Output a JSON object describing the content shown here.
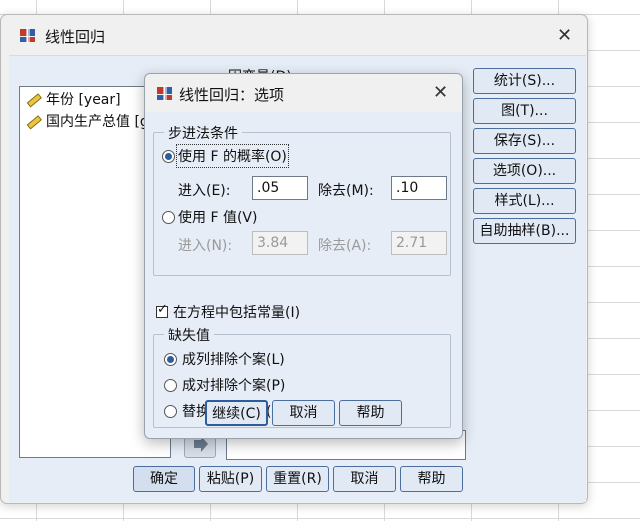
{
  "main_dialog": {
    "title": "线性回归",
    "dependent_label": "因变量(D):",
    "variables": [
      {
        "label": "年份 [year]"
      },
      {
        "label": "国内生产总值 [gdp]"
      }
    ],
    "side_buttons": [
      "统计(S)...",
      "图(T)...",
      "保存(S)...",
      "选项(O)...",
      "样式(L)...",
      "自助抽样(B)..."
    ],
    "bottom_buttons": [
      "确定",
      "粘贴(P)",
      "重置(R)",
      "取消",
      "帮助"
    ]
  },
  "options_dialog": {
    "title": "线性回归：选项",
    "stepping_group": {
      "label": "步进法条件",
      "use_probability": {
        "label": "使用 F 的概率(O)",
        "selected": true
      },
      "entry_label": "进入(E):",
      "entry_value": ".05",
      "removal_label": "除去(M):",
      "removal_value": ".10",
      "use_value": {
        "label": "使用 F 值(V)",
        "selected": false
      },
      "entry_f_label": "进入(N):",
      "entry_f_value": "3.84",
      "removal_f_label": "除去(A):",
      "removal_f_value": "2.71"
    },
    "include_constant": {
      "label": "在方程中包括常量(I)",
      "checked": true
    },
    "missing_group": {
      "label": "缺失值",
      "options": [
        {
          "label": "成列排除个案(L)",
          "selected": true
        },
        {
          "label": "成对排除个案(P)",
          "selected": false
        },
        {
          "label": "替换为平均值(R)",
          "selected": false
        }
      ]
    },
    "buttons": {
      "continue": "继续(C)",
      "cancel": "取消",
      "help": "帮助"
    }
  },
  "colors": {
    "accent": "#2c5d9c",
    "dialog_body": "#e6edf7",
    "button_face": "#e1e9f5"
  }
}
